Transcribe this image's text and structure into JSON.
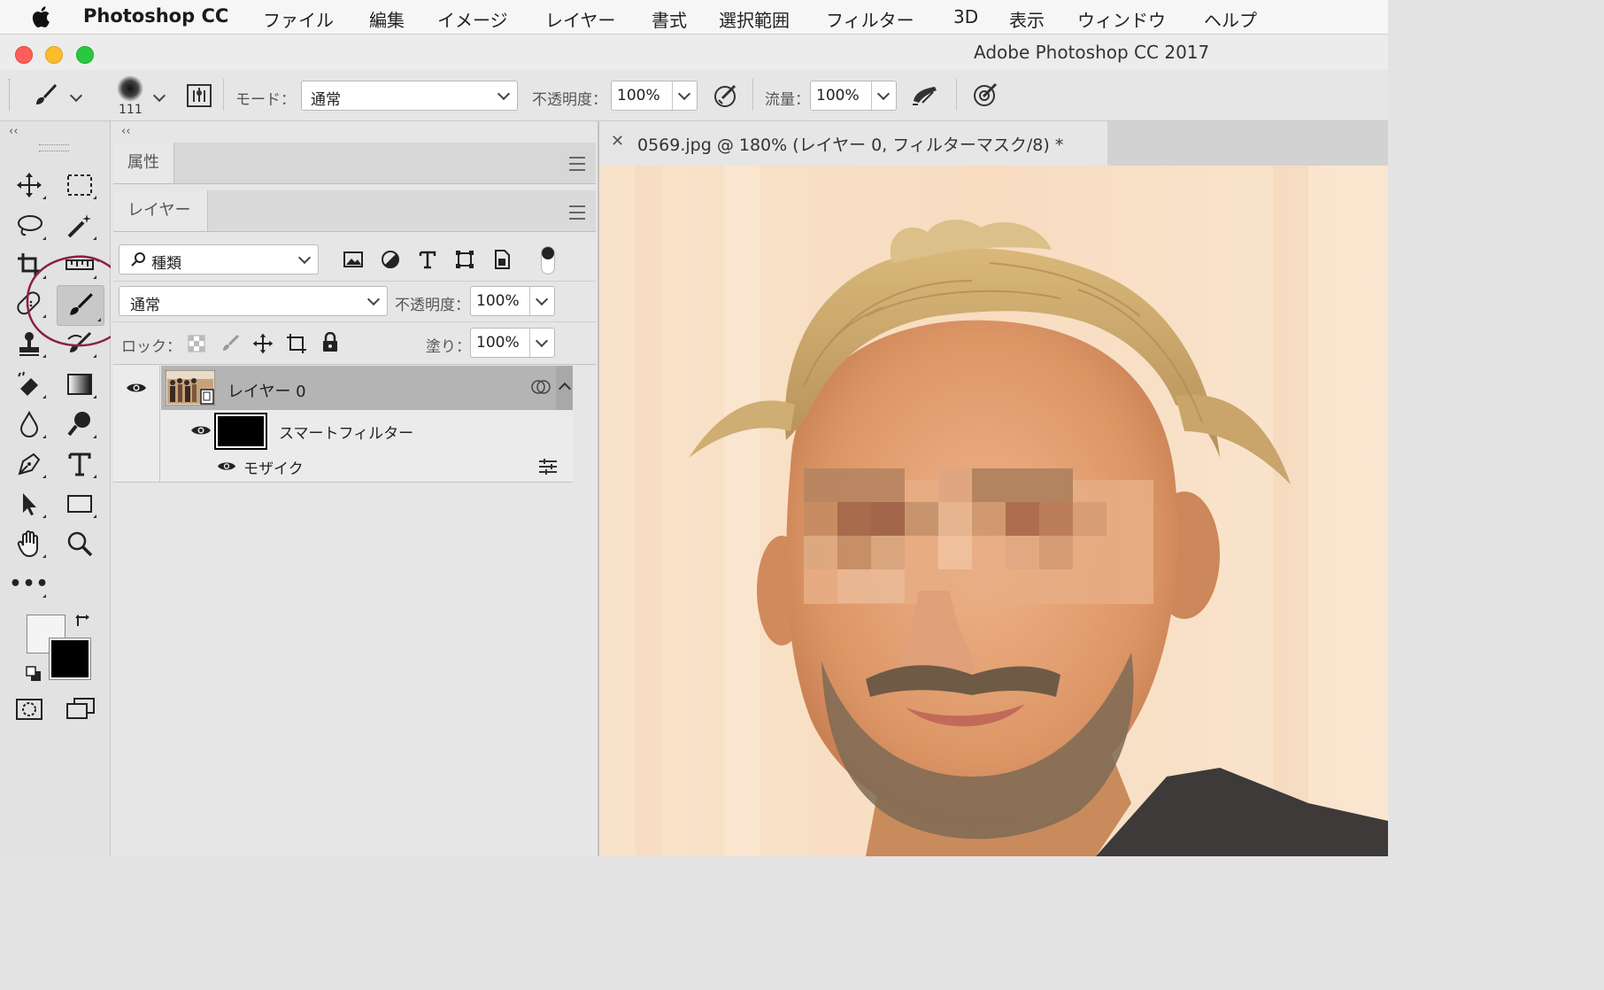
{
  "menubar": {
    "app_name": "Photoshop CC",
    "items": [
      "ファイル",
      "編集",
      "イメージ",
      "レイヤー",
      "書式",
      "選択範囲",
      "フィルター",
      "3D",
      "表示",
      "ウィンドウ",
      "ヘルプ"
    ]
  },
  "window": {
    "title": "Adobe Photoshop CC 2017"
  },
  "options": {
    "brush_size": "111",
    "mode_label": "モード：",
    "mode_value": "通常",
    "opacity_label": "不透明度：",
    "opacity_value": "100%",
    "flow_label": "流量：",
    "flow_value": "100%"
  },
  "panels": {
    "properties_tab": "属性",
    "layers_tab": "レイヤー",
    "filter_kind": "種類",
    "blend_mode": "通常",
    "opacity_label": "不透明度：",
    "opacity_value": "100%",
    "lock_label": "ロック：",
    "fill_label": "塗り：",
    "fill_value": "100%",
    "layers": [
      {
        "name": "レイヤー 0"
      },
      {
        "name": "スマートフィルター"
      },
      {
        "name": "モザイク"
      }
    ]
  },
  "document": {
    "tab_title": "0569.jpg @ 180% (レイヤー 0, フィルターマスク/8) *"
  },
  "colors": {
    "highlight_circle": "#8c1f4a",
    "foreground": "#000000",
    "background": "#f4f4f4",
    "selected_layer": "#b4b4b4"
  },
  "icons": [
    "apple-icon",
    "brush-icon",
    "brush-preset-icon",
    "toggle-brush-panel-icon",
    "airbrush-icon",
    "pressure-opacity-icon",
    "pressure-size-icon",
    "move-icon",
    "marquee-icon",
    "lasso-icon",
    "magic-wand-icon",
    "crop-icon",
    "ruler-icon",
    "healing-icon",
    "brush-tool-icon",
    "stamp-icon",
    "history-brush-icon",
    "eraser-icon",
    "gradient-icon",
    "blur-icon",
    "dodge-icon",
    "pen-icon",
    "type-icon",
    "path-select-icon",
    "rectangle-icon",
    "hand-icon",
    "zoom-icon",
    "more-tools-icon",
    "swap-colors-icon",
    "default-colors-icon",
    "quick-mask-icon",
    "screen-mode-icon",
    "eye-icon",
    "smart-object-icon",
    "filter-options-icon"
  ]
}
